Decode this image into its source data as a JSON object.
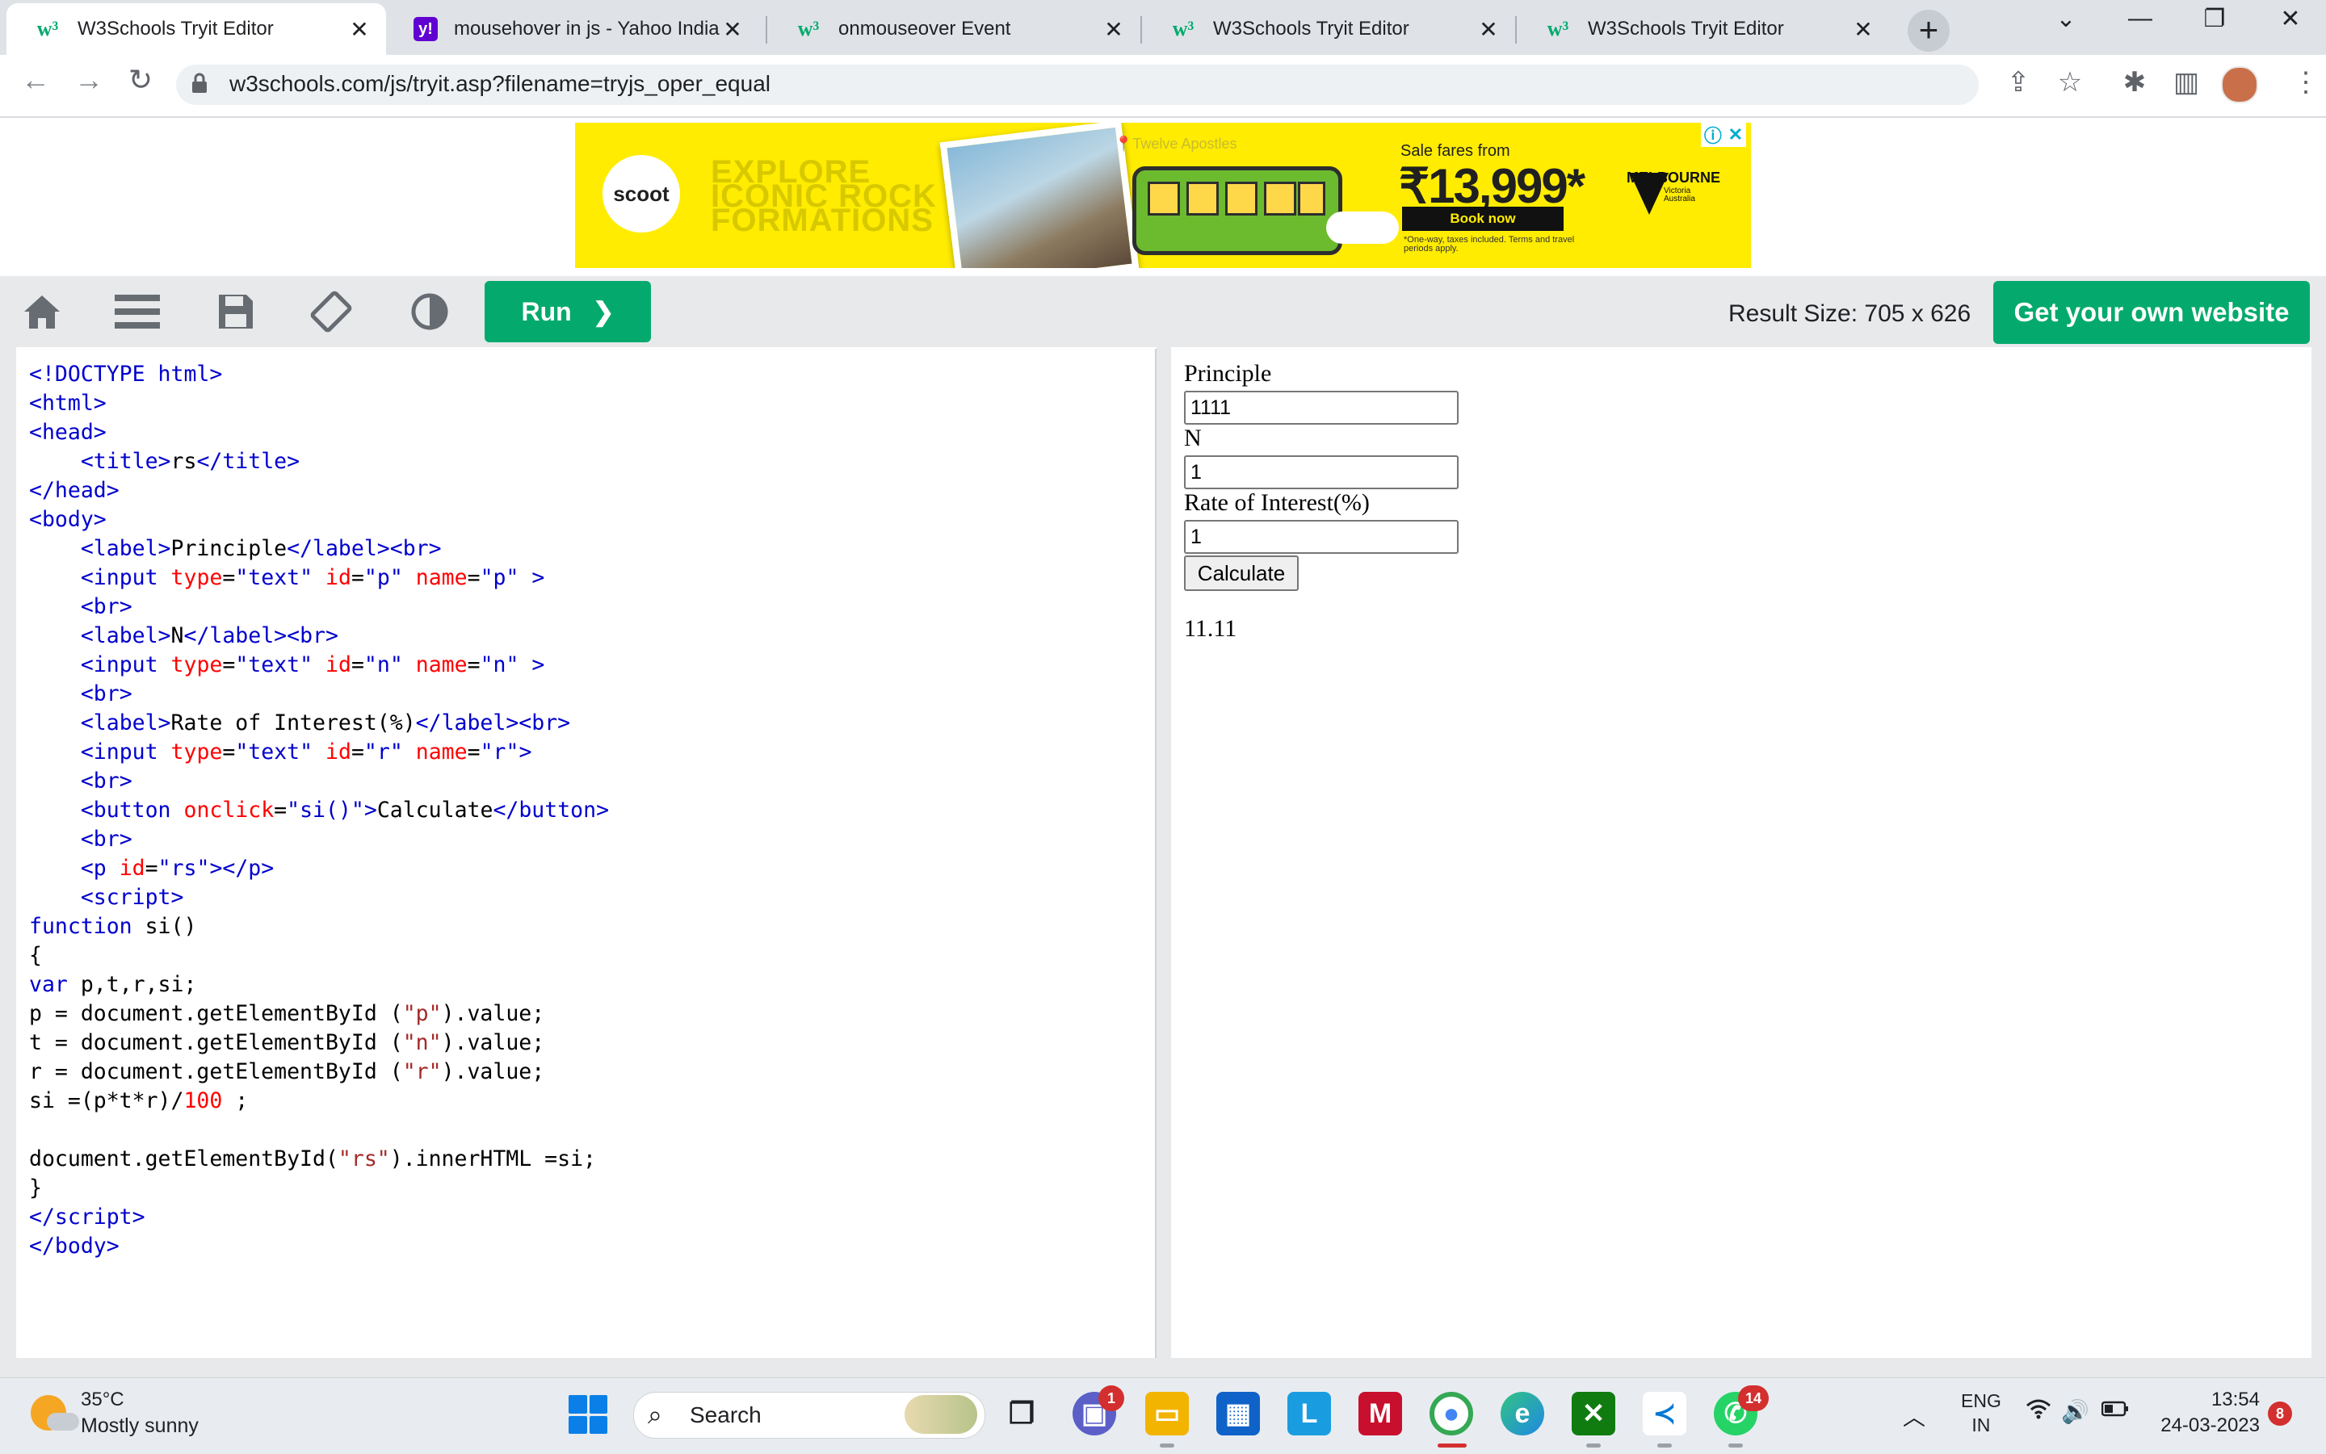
{
  "browser": {
    "tabs": [
      {
        "title": "W3Schools Tryit Editor",
        "favicon": "w3schools-icon",
        "active": true
      },
      {
        "title": "mousehover in js - Yahoo India",
        "favicon": "yahoo-icon",
        "active": false
      },
      {
        "title": "onmouseover Event",
        "favicon": "w3schools-icon",
        "active": false
      },
      {
        "title": "W3Schools Tryit Editor",
        "favicon": "w3schools-icon",
        "active": false
      },
      {
        "title": "W3Schools Tryit Editor",
        "favicon": "w3schools-icon",
        "active": false
      }
    ],
    "url": "w3schools.com/js/tryit.asp?filename=tryjs_oper_equal"
  },
  "ad": {
    "brand": "scoot",
    "headline": "EXPLORE ICONIC ROCK FORMATIONS",
    "location": "Twelve Apostles",
    "sale_label": "Sale fares from",
    "price": "₹13,999*",
    "cta": "Book now",
    "fine_print": "*One-way, taxes included. Terms and travel periods apply.",
    "partner": "MELBOURNE",
    "partner_sub": "Victoria Australia"
  },
  "editor": {
    "run_label": "Run",
    "result_size": "Result Size: 705 x 626",
    "get_website_label": "Get your own website"
  },
  "result": {
    "principle_label": "Principle",
    "principle_value": "1111",
    "n_label": "N",
    "n_value": "1",
    "rate_label": "Rate of Interest(%)",
    "rate_value": "1",
    "button_label": "Calculate",
    "output": "11.11"
  },
  "taskbar": {
    "temperature": "35°C",
    "condition": "Mostly sunny",
    "search_placeholder": "Search",
    "teams_badge": "1",
    "whatsapp_badge": "14",
    "lang_line1": "ENG",
    "lang_line2": "IN",
    "time": "13:54",
    "date": "24-03-2023",
    "notifications": "8"
  },
  "colors": {
    "w3_green": "#04aa6d",
    "code_tag": "#0000cd",
    "code_attr": "#ff0000",
    "code_string": "#a52a2a",
    "ad_yellow": "#ffec00"
  }
}
